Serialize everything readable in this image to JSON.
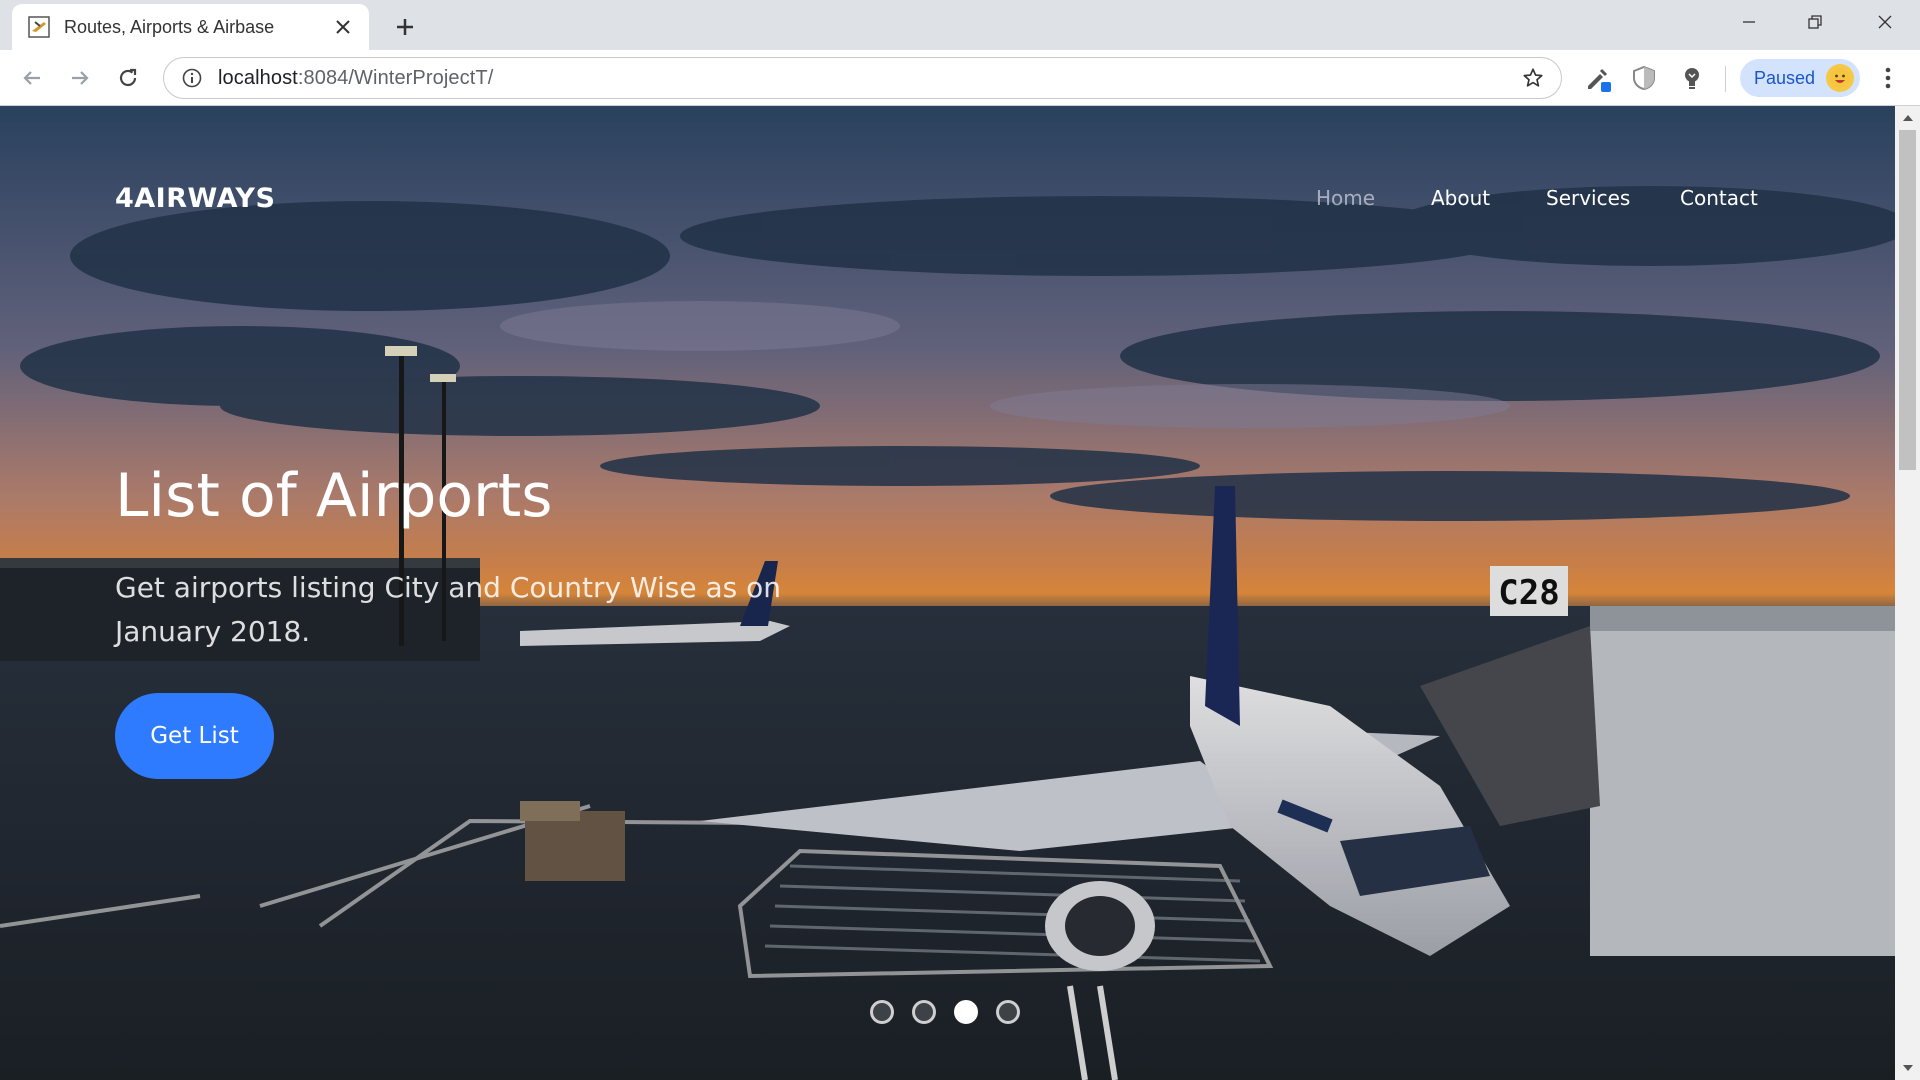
{
  "browser": {
    "tab_title": "Routes, Airports & Airbase",
    "url_host": "localhost",
    "url_rest": ":8084/WinterProjectT/",
    "profile_label": "Paused"
  },
  "site": {
    "brand": "4AIRWAYS",
    "nav": [
      {
        "label": "Home",
        "active": true
      },
      {
        "label": "About",
        "active": false
      },
      {
        "label": "Services",
        "active": false
      },
      {
        "label": "Contact",
        "active": false
      }
    ]
  },
  "hero": {
    "title": "List of Airports",
    "subtitle": "Get airports listing City and Country Wise as on January 2018.",
    "button": "Get List",
    "slides_total": 4,
    "active_slide": 3,
    "gate_sign": "C28"
  },
  "colors": {
    "accent_button": "#2f7bff",
    "profile_chip": "#d3e3fd"
  }
}
